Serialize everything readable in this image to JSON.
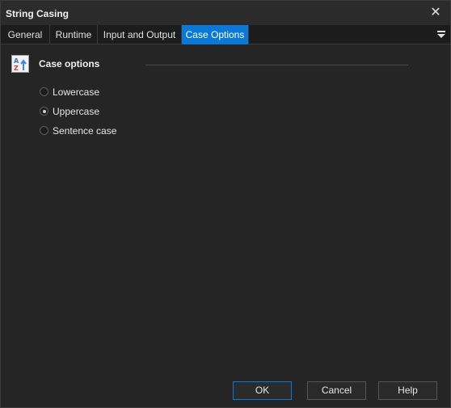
{
  "window": {
    "title": "String Casing",
    "close_glyph": "✕"
  },
  "tabs": [
    {
      "label": "General"
    },
    {
      "label": "Runtime"
    },
    {
      "label": "Input and Output"
    },
    {
      "label": "Case Options",
      "active": true
    }
  ],
  "section": {
    "title": "Case options",
    "icon": "sort-az-icon"
  },
  "options": [
    {
      "label": "Lowercase",
      "checked": false
    },
    {
      "label": "Uppercase",
      "checked": true
    },
    {
      "label": "Sentence case",
      "checked": false
    }
  ],
  "buttons": {
    "ok": "OK",
    "cancel": "Cancel",
    "help": "Help"
  },
  "colors": {
    "accent": "#0a78d7",
    "background": "#252526"
  }
}
